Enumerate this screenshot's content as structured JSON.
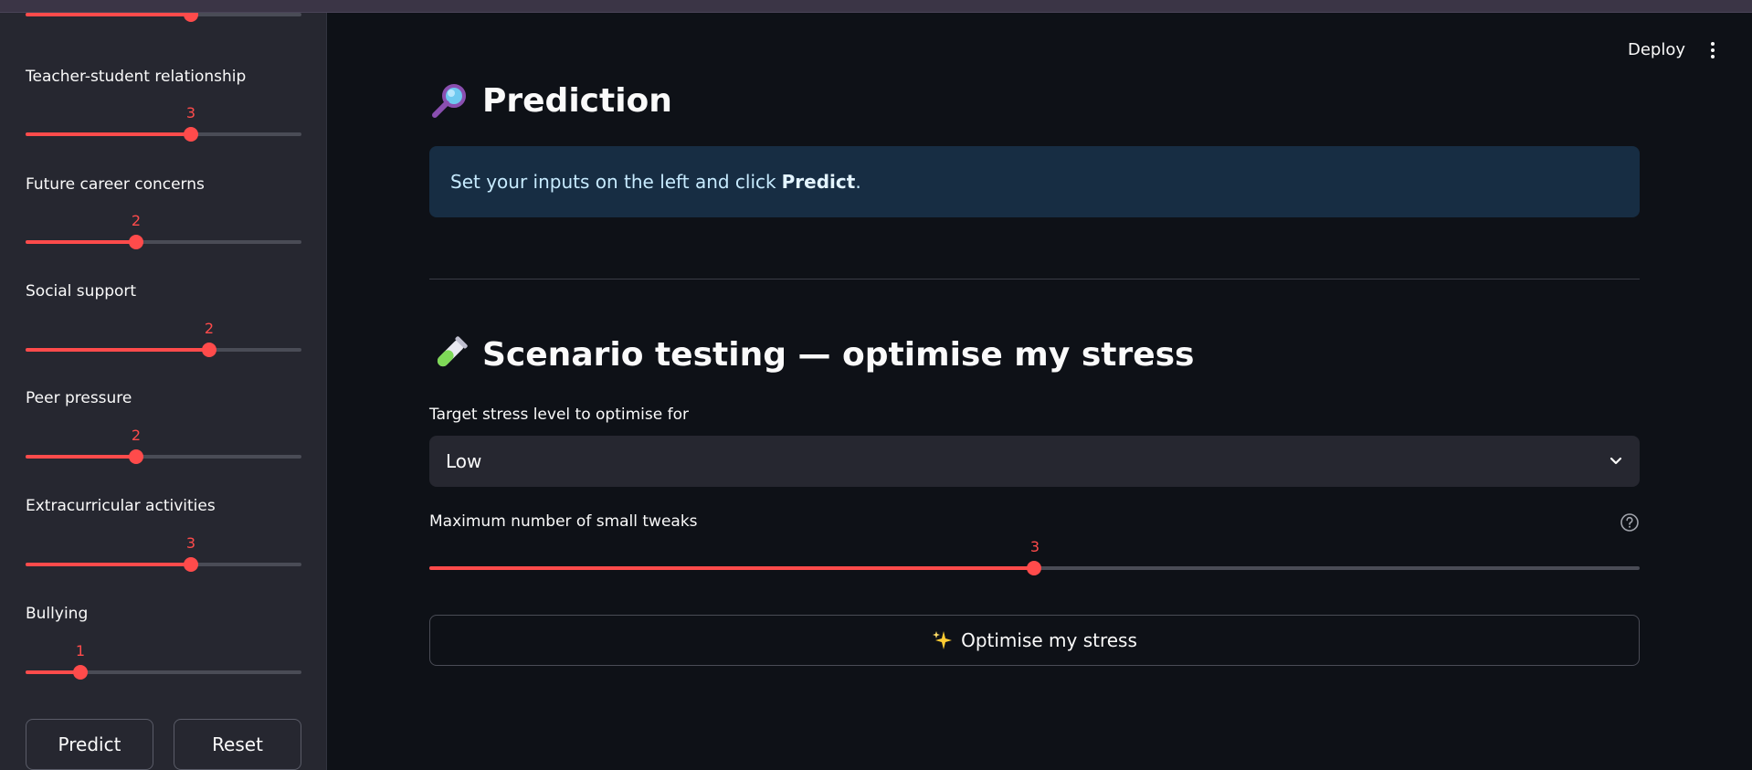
{
  "sidebar": {
    "sliders": [
      {
        "label": "",
        "value": "",
        "fraction": 0.6
      },
      {
        "label": "Teacher-student relationship",
        "value": "3",
        "fraction": 0.6
      },
      {
        "label": "Future career concerns",
        "value": "2",
        "fraction": 0.4
      },
      {
        "label": "Social support",
        "value": "2",
        "fraction": 0.667
      },
      {
        "label": "Peer pressure",
        "value": "2",
        "fraction": 0.4
      },
      {
        "label": "Extracurricular activities",
        "value": "3",
        "fraction": 0.6
      },
      {
        "label": "Bullying",
        "value": "1",
        "fraction": 0.2
      }
    ],
    "predict_label": "Predict",
    "reset_label": "Reset"
  },
  "header": {
    "deploy_label": "Deploy",
    "menu_icon": "kebab-icon"
  },
  "prediction": {
    "title": "Prediction",
    "icon": "magnifying-glass-icon",
    "info_text": "Set your inputs on the left and click ",
    "info_bold": "Predict",
    "info_end": "."
  },
  "scenario": {
    "title": "Scenario testing — optimise my stress",
    "icon": "test-tube-icon",
    "target_label": "Target stress level to optimise for",
    "target_value": "Low",
    "tweaks_label": "Maximum number of small tweaks",
    "tweaks_value": "3",
    "tweaks_fraction": 0.5,
    "optimise_label": "Optimise my stress",
    "optimise_icon": "sparkles-icon"
  },
  "colors": {
    "accent": "#ff4b4b",
    "background": "#0e1117",
    "sidebar": "#262730",
    "info_bg": "#172d43"
  }
}
